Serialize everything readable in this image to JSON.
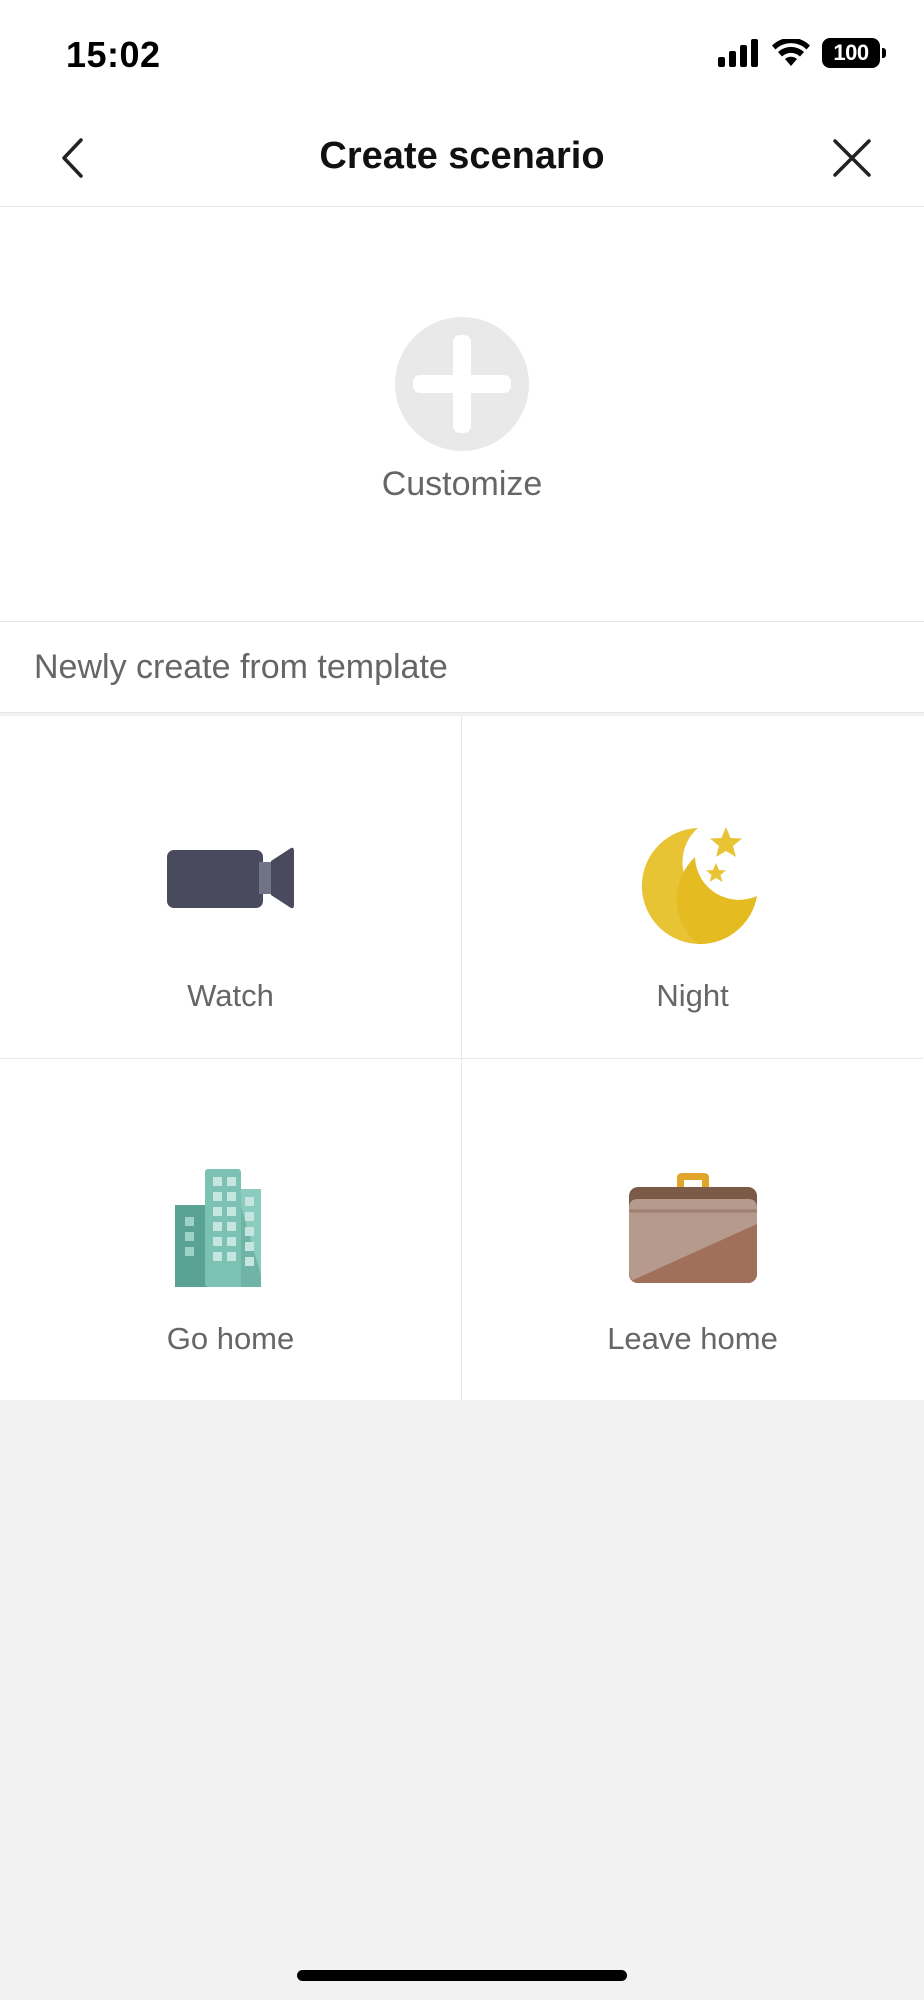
{
  "status_bar": {
    "time": "15:02",
    "battery": "100"
  },
  "nav": {
    "title": "Create scenario",
    "back_icon": "chevron-left-icon",
    "close_icon": "close-icon"
  },
  "customize": {
    "label": "Customize",
    "icon": "plus-icon"
  },
  "template_section": {
    "header": "Newly create from template"
  },
  "templates": [
    {
      "label": "Watch",
      "icon": "video-camera-icon"
    },
    {
      "label": "Night",
      "icon": "moon-stars-icon"
    },
    {
      "label": "Go home",
      "icon": "building-icon"
    },
    {
      "label": "Leave home",
      "icon": "briefcase-icon"
    }
  ],
  "colors": {
    "background": "#f3f2f3",
    "surface": "#ffffff",
    "label_gray": "#666666",
    "camera": "#4a4a5e",
    "moon": "#e8c434",
    "building": "#6fb8ab",
    "briefcase": "#a0705a"
  }
}
